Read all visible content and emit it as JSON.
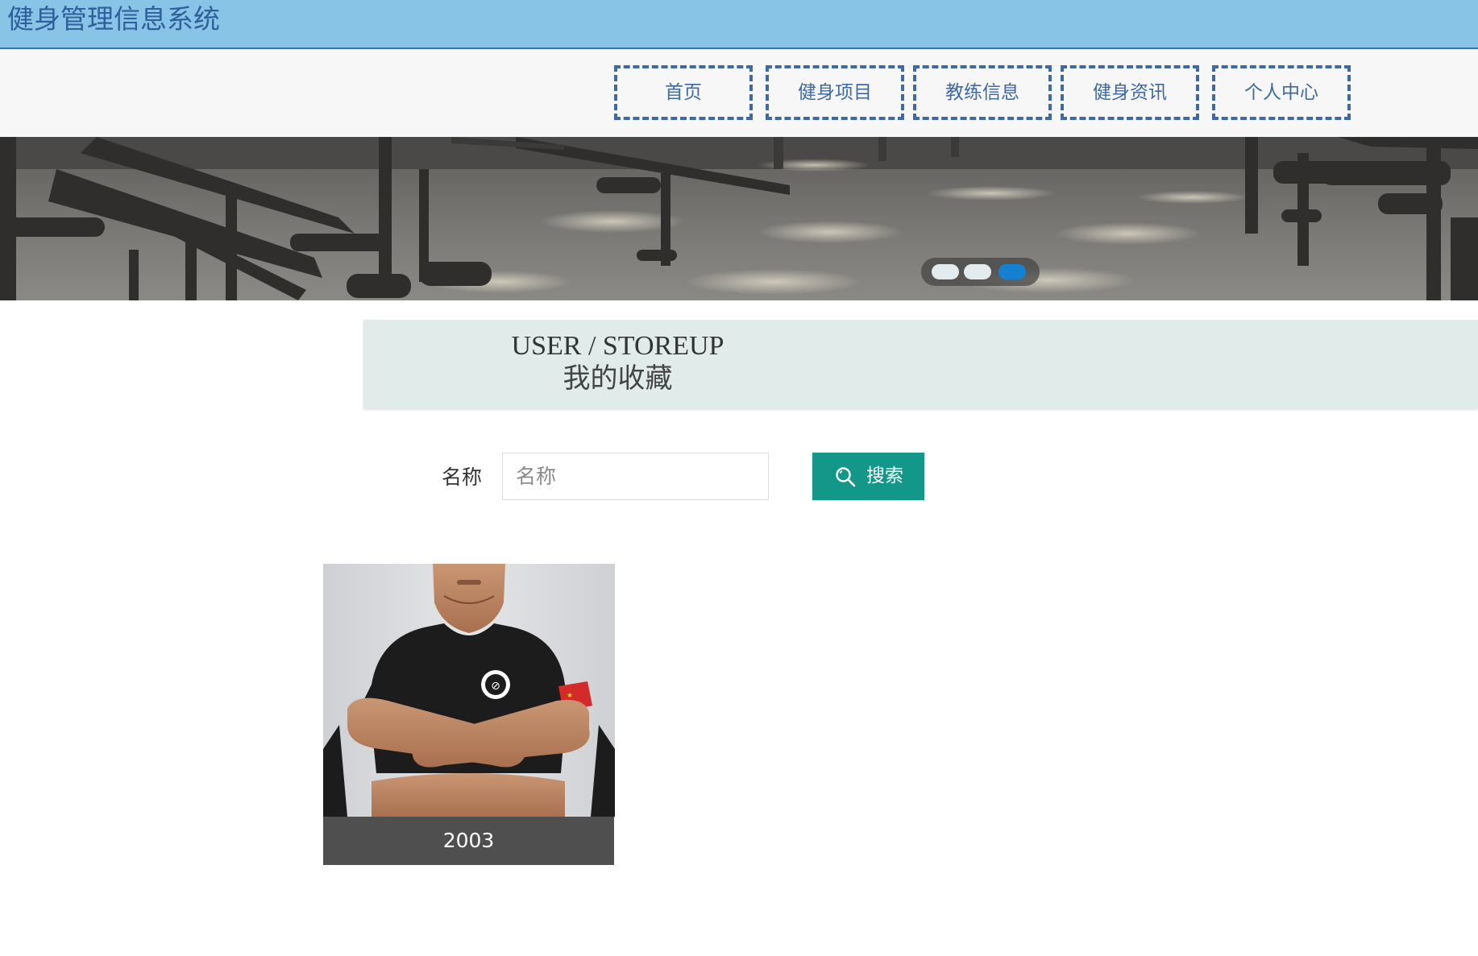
{
  "site": {
    "title": "健身管理信息系统"
  },
  "nav": {
    "items": [
      {
        "label": "首页"
      },
      {
        "label": "健身项目"
      },
      {
        "label": "教练信息"
      },
      {
        "label": "健身资讯"
      },
      {
        "label": "个人中心"
      }
    ]
  },
  "carousel": {
    "slide_count": 3,
    "active_index": 2,
    "colors": {
      "dot": "#e3ebee",
      "dot_active": "#1680d0"
    }
  },
  "page_heading": {
    "english": "USER / STOREUP",
    "chinese": "我的收藏"
  },
  "search": {
    "label": "名称",
    "placeholder": "名称",
    "value": "",
    "button_label": "搜索",
    "button_icon": "search-icon"
  },
  "favorites": [
    {
      "caption": "2003",
      "image": "coach-photo"
    }
  ],
  "colors": {
    "title_bar": "#87c4e6",
    "nav_border": "#3f69a3",
    "heading_band": "#e1ebea",
    "search_button": "#139789",
    "card_caption_bg": "#4f4f4f"
  }
}
